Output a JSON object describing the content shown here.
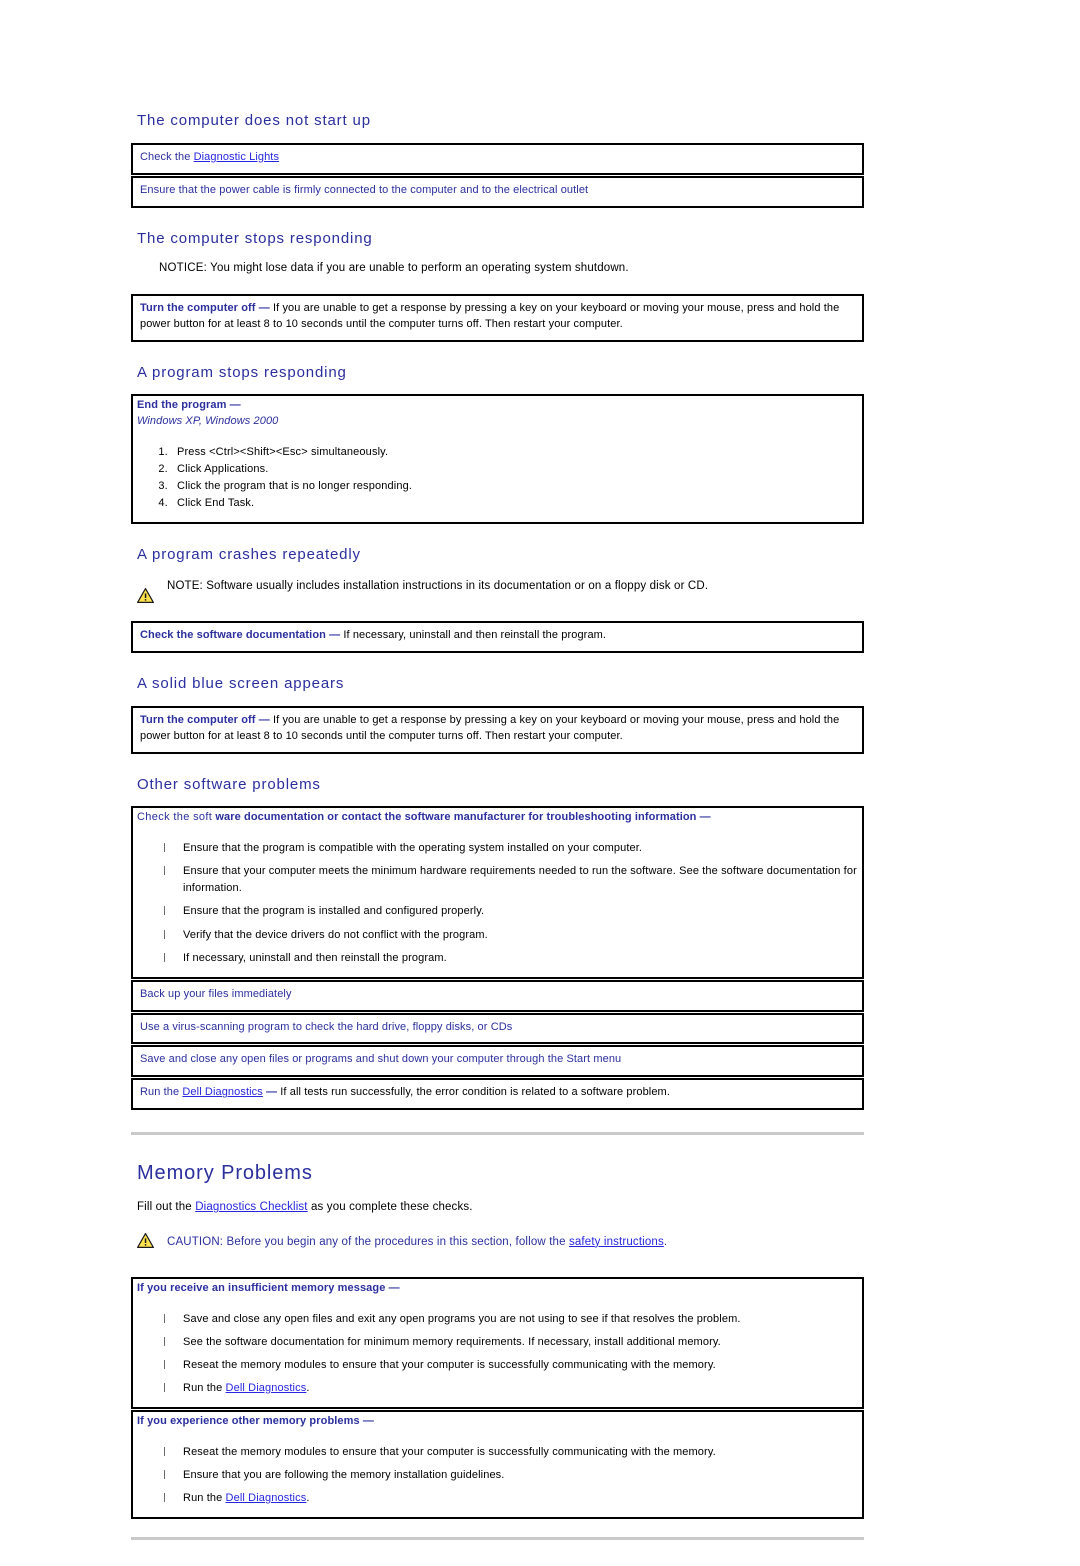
{
  "colors": {
    "heading_blue": "#2b2f9e",
    "link_blue": "#2626e0",
    "body_black": "#000000",
    "rule_gray": "#c9c9c9",
    "warn_yellow": "#ffe34d",
    "border_black": "#000000"
  },
  "sections": {
    "no_start": {
      "heading": "The computer does not start up",
      "rows": [
        {
          "prefix": "Check the ",
          "link": "Diagnostic Lights",
          "suffix": ""
        },
        {
          "prefix": "Ensure that the power cable is firmly connected to the computer and to the electrical outlet",
          "link": "",
          "suffix": ""
        }
      ]
    },
    "stops_responding": {
      "heading": "The computer stops responding",
      "notice_label": "NOTICE:",
      "notice_text": " You might lose data if you are unable to perform an operating system shutdown.",
      "box_lead": "Turn the computer off",
      "box_dash": "—",
      "box_body": "If you are unable to get a response by pressing a key on your keyboard or moving your mouse, press and hold the power button for at least 8 to 10 seconds until the computer turns off. Then restart your computer."
    },
    "program_stops": {
      "heading": "A program stops responding",
      "box_lead": "End the program",
      "box_dash": "—",
      "os_line": "Windows XP, Windows 2000",
      "steps": [
        "Press <Ctrl><Shift><Esc> simultaneously.",
        "Click Applications.",
        "Click the program that is no longer responding.",
        "Click End Task."
      ]
    },
    "program_crashes": {
      "heading": "A program crashes repeatedly",
      "note_icon": "warning-triangle-icon",
      "note_label": "NOTE:",
      "note_text": " Software usually includes installation instructions in its documentation or on a floppy disk or CD.",
      "box_lead": "Check the software documentation",
      "box_dash": "—",
      "box_body": "If necessary, uninstall and then reinstall the program."
    },
    "blue_screen": {
      "heading": "A solid blue screen appears",
      "box_lead": "Turn the computer off",
      "box_dash": "—",
      "box_body": "If you are unable to get a response by pressing a key on your keyboard or moving your mouse, press and hold the power button for at least 8 to 10 seconds until the computer turns off. Then restart your computer."
    },
    "other_software": {
      "heading": "Other software problems",
      "box_lead_regular": "Check the soft",
      "box_lead_bold": "ware documentation or contact the software manufacturer for troubleshooting information",
      "box_dash": "—",
      "bullets": [
        "Ensure that the program is compatible with the operating system installed on your computer.",
        "Ensure that your computer meets the minimum hardware requirements needed to run the software. See the software documentation for information.",
        "Ensure that the program is installed and configured properly.",
        "Verify that the device drivers do not conflict with the program.",
        "If necessary, uninstall and then reinstall the program."
      ],
      "rows": [
        {
          "text": "Back up your files immediately"
        },
        {
          "text": "Use a virus-scanning program to check the hard drive, floppy disks, or CDs"
        },
        {
          "text": "Save and close any open files or programs and shut down your computer through the Start menu"
        }
      ],
      "last_row": {
        "prefix": "Run the ",
        "link": "Dell Diagnostics",
        "dash": "—",
        "suffix": "If all tests run successfully, the error condition is related to a software problem."
      }
    },
    "memory": {
      "heading": "Memory Problems",
      "intro_prefix": "Fill out the ",
      "intro_link": "Diagnostics Checklist",
      "intro_suffix": " as you complete these checks.",
      "caution_icon": "warning-triangle-icon",
      "caution_label": "CAUTION:",
      "caution_text": " Before you begin any of the procedures in this section, follow the ",
      "caution_link": "safety instructions",
      "caution_end": ".",
      "block1": {
        "lead": "If you receive an insufficient memory message",
        "dash": "—",
        "bullets": [
          {
            "text": "Save and close any open files and exit any open programs you are not using to see if that resolves the problem."
          },
          {
            "text": "See the software documentation for minimum memory requirements. If necessary, install additional memory."
          },
          {
            "text": "Reseat the memory modules to ensure that your computer is successfully communicating with the memory."
          },
          {
            "prefix": "Run the ",
            "link": "Dell Diagnostics",
            "suffix": "."
          }
        ]
      },
      "block2": {
        "lead": "If you experience other memory problems",
        "dash": "—",
        "bullets": [
          {
            "text": "Reseat the memory modules to ensure that your computer is successfully communicating with the memory."
          },
          {
            "text": "Ensure that you are following the memory installation guidelines."
          },
          {
            "prefix": "Run the ",
            "link": "Dell Diagnostics",
            "suffix": "."
          }
        ]
      }
    }
  }
}
